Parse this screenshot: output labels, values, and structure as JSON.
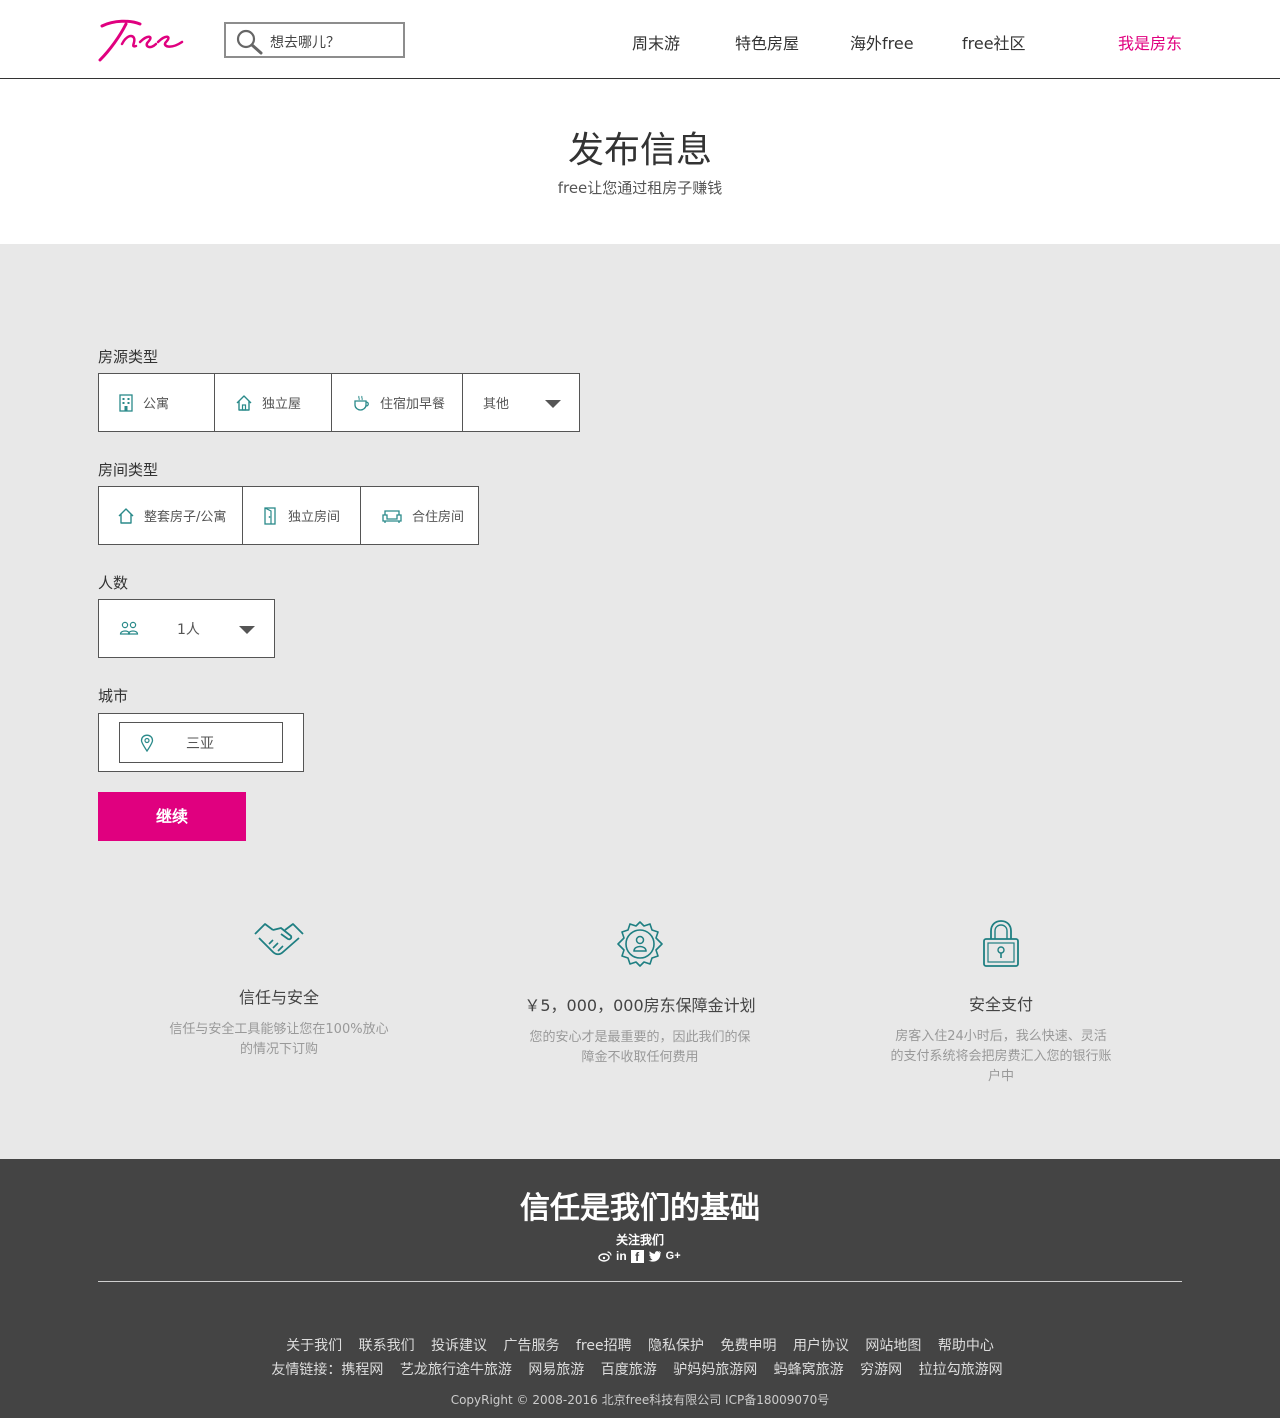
{
  "header": {
    "logo_text": "Free",
    "search_placeholder": "想去哪儿？",
    "nav": [
      "周末游",
      "特色房屋",
      "海外free",
      "free社区"
    ],
    "host_link": "我是房东",
    "brand_color": "#e0007f"
  },
  "hero": {
    "title": "发布信息",
    "subtitle": "free让您通过租房子赚钱"
  },
  "form": {
    "property_type": {
      "label": "房源类型",
      "options": [
        {
          "label": "公寓",
          "icon": "building-icon"
        },
        {
          "label": "独立屋",
          "icon": "house-icon"
        },
        {
          "label": "住宿加早餐",
          "icon": "coffee-cup-icon"
        },
        {
          "label": "其他",
          "icon": "chevron-down-icon"
        }
      ]
    },
    "room_type": {
      "label": "房间类型",
      "options": [
        {
          "label": "整套房子/公寓",
          "icon": "house-icon"
        },
        {
          "label": "独立房间",
          "icon": "door-icon"
        },
        {
          "label": "合住房间",
          "icon": "sofa-icon"
        }
      ]
    },
    "guests": {
      "label": "人数",
      "value": "1人",
      "icon": "people-icon"
    },
    "city": {
      "label": "城市",
      "value": "三亚",
      "icon": "location-pin-icon"
    },
    "continue_label": "继续"
  },
  "features": [
    {
      "icon": "handshake-icon",
      "title": "信任与安全",
      "desc_lines": [
        "信任与安全工具能够让您在100%放心",
        "的情况下订购"
      ]
    },
    {
      "icon": "badge-icon",
      "title": "￥5，000，000房东保障金计划",
      "desc_lines": [
        "您的安心才是最重要的，因此我们的保",
        "障金不收取任何费用"
      ]
    },
    {
      "icon": "lock-icon",
      "title": "安全支付",
      "desc_lines": [
        "房客入住24小时后，我么快速、灵活",
        "的支付系统将会把房费汇入您的银行账",
        "户中"
      ]
    }
  ],
  "footer": {
    "title": "信任是我们的基础",
    "follow_label": "关注我们",
    "socials": [
      "weibo-icon",
      "linkedin-icon",
      "facebook-icon",
      "twitter-icon",
      "google-plus-icon"
    ],
    "social_text": [
      "in",
      "f",
      "G+"
    ],
    "links": [
      "关于我们",
      "联系我们",
      "投诉建议",
      "广告服务",
      "free招聘",
      "隐私保护",
      "免费申明",
      "用户协议",
      "网站地图",
      "帮助中心"
    ],
    "friend_label": "友情链接：",
    "friend_links": [
      "携程网",
      "艺龙旅行途牛旅游",
      "网易旅游",
      "百度旅游",
      "驴妈妈旅游网",
      "蚂蜂窝旅游",
      "穷游网",
      "拉拉勾旅游网"
    ],
    "copyright": "CopyRight © 2008-2016 北京free科技有限公司  ICP备18009070号"
  }
}
